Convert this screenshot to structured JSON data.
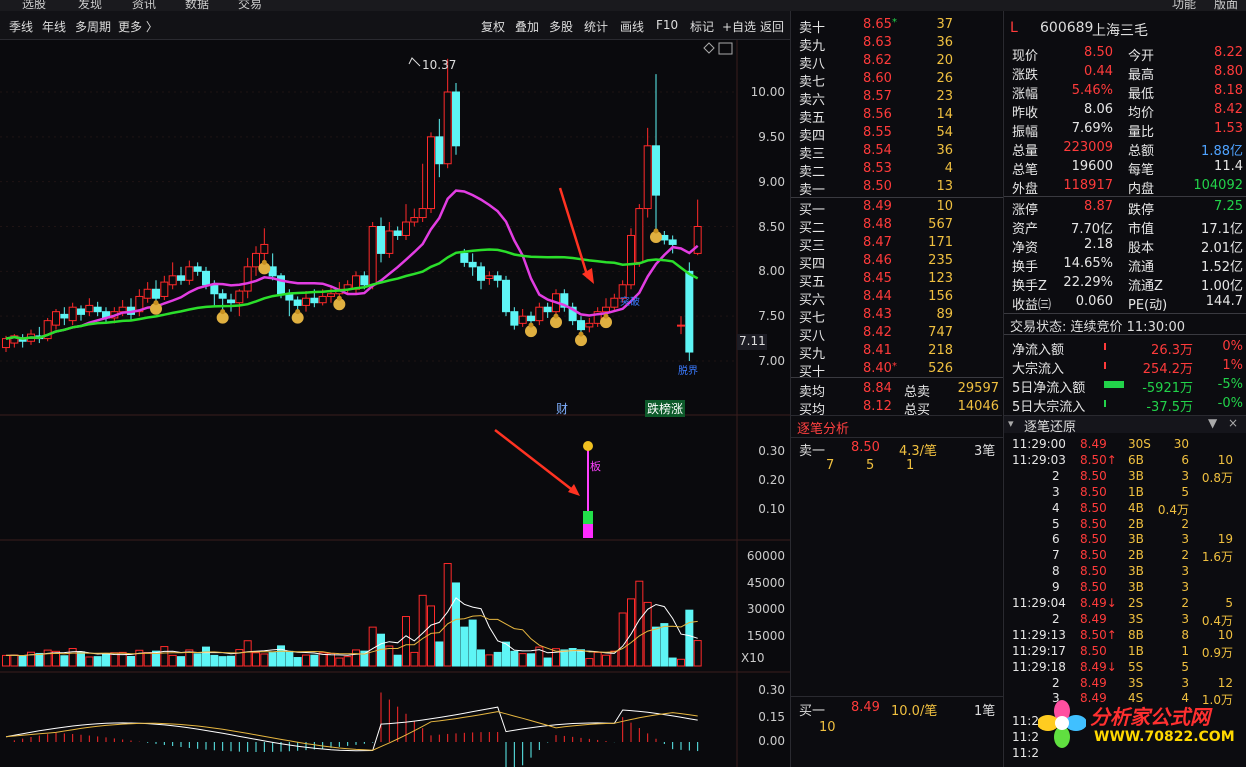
{
  "top_menu": [
    "选股",
    "发现",
    "资讯",
    "数据",
    "交易",
    "功能",
    "版面"
  ],
  "toolbar": {
    "left": [
      "季线",
      "年线",
      "多周期",
      "更多 〉"
    ],
    "right": [
      "复权",
      "叠加",
      "多股",
      "统计",
      "画线",
      "F10",
      "标记",
      "+自选",
      "返回"
    ]
  },
  "chart": {
    "price_axis": [
      "10.00",
      "9.50",
      "9.00",
      "8.50",
      "8.00",
      "7.50",
      "7.00"
    ],
    "current_price_tag": "7.11",
    "high_label": "10.37",
    "event_labels": {
      "cai": "财",
      "dietbang": "跌榜涨"
    },
    "ind1_axis": [
      "0.30",
      "0.20",
      "0.10"
    ],
    "ind1_text": "板",
    "vol_axis": [
      "60000",
      "45000",
      "30000",
      "15000"
    ],
    "vol_unit": "X10",
    "ind3_axis": [
      "0.30",
      "0.15",
      "0.00"
    ],
    "markers": {
      "m1": "突破",
      "m2": "脱界"
    },
    "colors": {
      "up": "#ff2a2a",
      "down": "#5ef5f5",
      "ma_magenta": "#e23de2",
      "ma_green": "#2bdf2b"
    }
  },
  "order_book": {
    "sells": [
      {
        "label": "卖十",
        "price": "8.65",
        "vol": "37",
        "flag": "*"
      },
      {
        "label": "卖九",
        "price": "8.63",
        "vol": "36",
        "flag": ""
      },
      {
        "label": "卖八",
        "price": "8.62",
        "vol": "20",
        "flag": ""
      },
      {
        "label": "卖七",
        "price": "8.60",
        "vol": "26",
        "flag": ""
      },
      {
        "label": "卖六",
        "price": "8.57",
        "vol": "23",
        "flag": ""
      },
      {
        "label": "卖五",
        "price": "8.56",
        "vol": "14",
        "flag": ""
      },
      {
        "label": "卖四",
        "price": "8.55",
        "vol": "54",
        "flag": ""
      },
      {
        "label": "卖三",
        "price": "8.54",
        "vol": "36",
        "flag": ""
      },
      {
        "label": "卖二",
        "price": "8.53",
        "vol": "4",
        "flag": ""
      },
      {
        "label": "卖一",
        "price": "8.50",
        "vol": "13",
        "flag": ""
      }
    ],
    "buys": [
      {
        "label": "买一",
        "price": "8.49",
        "vol": "10",
        "flag": ""
      },
      {
        "label": "买二",
        "price": "8.48",
        "vol": "567",
        "flag": ""
      },
      {
        "label": "买三",
        "price": "8.47",
        "vol": "171",
        "flag": ""
      },
      {
        "label": "买四",
        "price": "8.46",
        "vol": "235",
        "flag": ""
      },
      {
        "label": "买五",
        "price": "8.45",
        "vol": "123",
        "flag": ""
      },
      {
        "label": "买六",
        "price": "8.44",
        "vol": "156",
        "flag": ""
      },
      {
        "label": "买七",
        "price": "8.43",
        "vol": "89",
        "flag": ""
      },
      {
        "label": "买八",
        "price": "8.42",
        "vol": "747",
        "flag": ""
      },
      {
        "label": "买九",
        "price": "8.41",
        "vol": "218",
        "flag": ""
      },
      {
        "label": "买十",
        "price": "8.40",
        "vol": "526",
        "flag": "*"
      }
    ],
    "avg_sell_label": "卖均",
    "avg_sell": "8.84",
    "total_sell_label": "总卖",
    "total_sell": "29597",
    "avg_buy_label": "买均",
    "avg_buy": "8.12",
    "total_buy_label": "总买",
    "total_buy": "14046"
  },
  "analysis": {
    "title": "逐笔分析",
    "sell1": {
      "label": "卖一",
      "price": "8.50",
      "per": "4.3/笔",
      "count": "3笔",
      "items": [
        "7",
        "5",
        "1"
      ]
    },
    "buy1": {
      "label": "买一",
      "price": "8.49",
      "per": "10.0/笔",
      "count": "1笔",
      "items": [
        "10"
      ]
    }
  },
  "stock": {
    "market": "L",
    "code": "600689",
    "name": "上海三毛",
    "rows": [
      [
        "现价",
        "8.50",
        "今开",
        "8.22"
      ],
      [
        "涨跌",
        "0.44",
        "最高",
        "8.80"
      ],
      [
        "涨幅",
        "5.46%",
        "最低",
        "8.18"
      ],
      [
        "昨收",
        "8.06",
        "均价",
        "8.42"
      ],
      [
        "振幅",
        "7.69%",
        "量比",
        "1.53"
      ],
      [
        "总量",
        "223009",
        "总额",
        "1.88亿"
      ],
      [
        "总笔",
        "19600",
        "每笔",
        "11.4"
      ],
      [
        "外盘",
        "118917",
        "内盘",
        "104092"
      ]
    ],
    "rows2": [
      [
        "涨停",
        "8.87",
        "跌停",
        "7.25"
      ],
      [
        "资产",
        "7.70亿",
        "市值",
        "17.1亿"
      ],
      [
        "净资",
        "2.18",
        "股本",
        "2.01亿"
      ],
      [
        "换手",
        "14.65%",
        "流通",
        "1.52亿"
      ],
      [
        "换手Z",
        "22.29%",
        "流通Z",
        "1.00亿"
      ],
      [
        "收益㈢",
        "0.060",
        "PE(动)",
        "144.7"
      ]
    ],
    "trade_status": "交易状态: 连续竞价 11:30:00",
    "flows": [
      {
        "label": "净流入额",
        "value": "26.3万",
        "pct": "0%"
      },
      {
        "label": "大宗流入",
        "value": "254.2万",
        "pct": "1%"
      },
      {
        "label": "5日净流入额",
        "value": "-5921万",
        "pct": "-5%"
      },
      {
        "label": "5日大宗流入",
        "value": "-37.5万",
        "pct": "-0%"
      }
    ],
    "tick_title": "逐笔还原",
    "ticks": [
      [
        "11:29:00",
        "8.49",
        "30S",
        "30",
        ""
      ],
      [
        "11:29:03",
        "8.50↑",
        "6B",
        "6",
        "10"
      ],
      [
        "2",
        "8.50",
        "3B",
        "3",
        "0.8万"
      ],
      [
        "3",
        "8.50",
        "1B",
        "5",
        ""
      ],
      [
        "4",
        "8.50",
        "4B",
        "0.4万",
        ""
      ],
      [
        "5",
        "8.50",
        "2B",
        "2",
        ""
      ],
      [
        "6",
        "8.50",
        "3B",
        "3",
        "19"
      ],
      [
        "7",
        "8.50",
        "2B",
        "2",
        "1.6万"
      ],
      [
        "8",
        "8.50",
        "3B",
        "3",
        ""
      ],
      [
        "9",
        "8.50",
        "3B",
        "3",
        ""
      ],
      [
        "11:29:04",
        "8.49↓",
        "2S",
        "2",
        "5"
      ],
      [
        "2",
        "8.49",
        "3S",
        "3",
        "0.4万"
      ],
      [
        "11:29:13",
        "8.50↑",
        "8B",
        "8",
        "10"
      ],
      [
        "11:29:17",
        "8.50",
        "1B",
        "1",
        "0.9万"
      ],
      [
        "11:29:18",
        "8.49↓",
        "5S",
        "5",
        ""
      ],
      [
        "2",
        "8.49",
        "3S",
        "3",
        "12"
      ],
      [
        "3",
        "8.49",
        "4S",
        "4",
        "1.0万"
      ]
    ],
    "tail_times": [
      "11:2",
      "11:2",
      "11:2"
    ]
  },
  "watermark": {
    "text": "分析家公式网",
    "url": "WWW.70822.COM"
  }
}
